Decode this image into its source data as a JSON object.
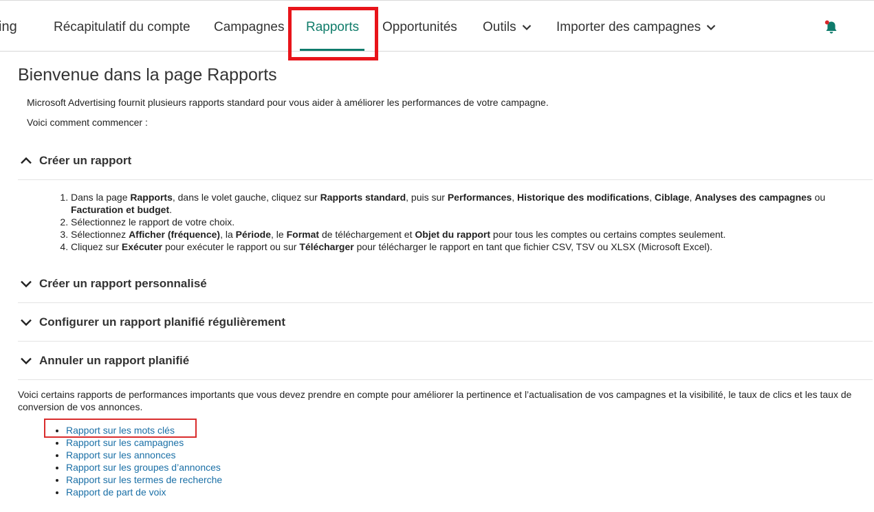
{
  "nav": {
    "brand": "ing",
    "items": [
      {
        "label": "Récapitulatif du compte"
      },
      {
        "label": "Campagnes"
      },
      {
        "label": "Rapports"
      },
      {
        "label": "Opportunités"
      },
      {
        "label": "Outils"
      },
      {
        "label": "Importer des campagnes"
      }
    ],
    "active": "Rapports",
    "accent_color": "#0f7b6c",
    "highlight_color": "#e8141a",
    "notification_icon": "bell-icon"
  },
  "page": {
    "title": "Bienvenue dans la page Rapports",
    "intro1": "Microsoft Advertising fournit plusieurs rapports standard pour vous aider à améliorer les performances de votre campagne.",
    "intro2": "Voici comment commencer :"
  },
  "sections": [
    {
      "title": "Créer un rapport",
      "expanded": true
    },
    {
      "title": "Créer un rapport personnalisé",
      "expanded": false
    },
    {
      "title": "Configurer un rapport planifié régulièrement",
      "expanded": false
    },
    {
      "title": "Annuler un rapport planifié",
      "expanded": false
    }
  ],
  "steps": {
    "s1": {
      "t1": "Dans la page ",
      "b1": "Rapports",
      "t2": ", dans le volet gauche, cliquez sur ",
      "b2": "Rapports standard",
      "t3": ", puis sur ",
      "b3": "Performances",
      "t4": ", ",
      "b4": "Historique des modifications",
      "t5": ", ",
      "b5": "Ciblage",
      "t6": ", ",
      "b6": "Analyses des campagnes",
      "t7": " ou ",
      "b7": "Facturation et budget",
      "t8": "."
    },
    "s2": {
      "t1": "Sélectionnez le rapport de votre choix."
    },
    "s3": {
      "t1": "Sélectionnez ",
      "b1": "Afficher (fréquence)",
      "t2": ", la ",
      "b2": "Période",
      "t3": ", le ",
      "b3": "Format",
      "t4": " de téléchargement et ",
      "b4": "Objet du rapport",
      "t5": " pour tous les comptes ou certains comptes seulement."
    },
    "s4": {
      "t1": "Cliquez sur ",
      "b1": "Exécuter",
      "t2": " pour exécuter le rapport ou sur ",
      "b2": "Télécharger",
      "t3": " pour télécharger le rapport en tant que fichier CSV, TSV ou XLSX (Microsoft Excel)."
    }
  },
  "paragraph": "Voici certains rapports de performances importants que vous devez prendre en compte pour améliorer la pertinence et l’actualisation de vos campagnes et la visibilité, le taux de clics et les taux de conversion de vos annonces.",
  "links": [
    "Rapport sur les mots clés",
    "Rapport sur les campagnes",
    "Rapport sur les annonces",
    "Rapport sur les groupes d’annonces",
    "Rapport sur les termes de recherche",
    "Rapport de part de voix"
  ]
}
